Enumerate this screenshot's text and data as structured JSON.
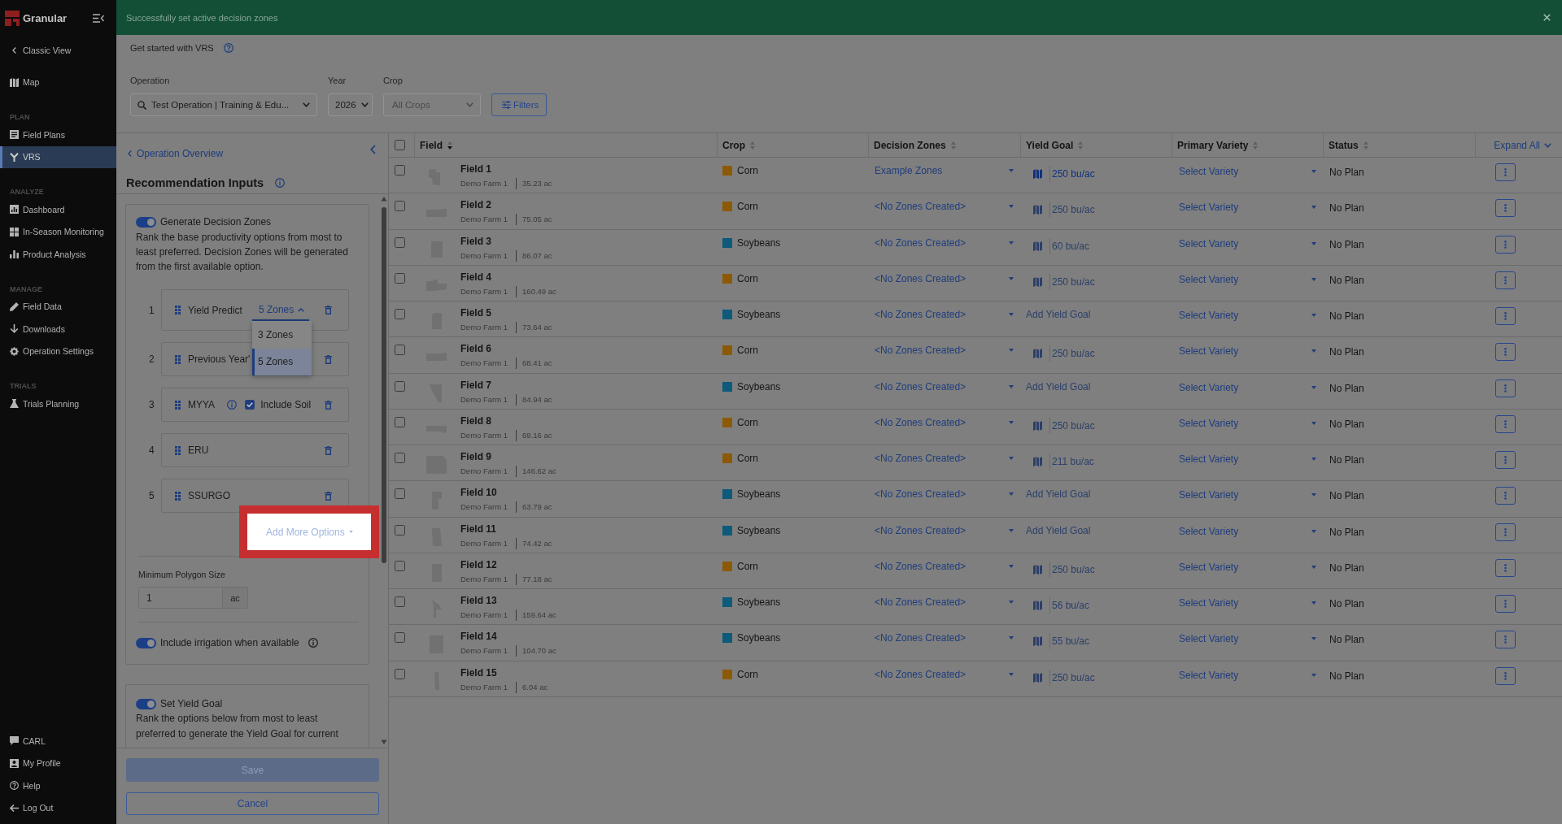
{
  "sidebar": {
    "brand": "Granular",
    "back_link": "Classic View",
    "sections": [
      {
        "items": [
          {
            "label": "Map",
            "selected": false
          }
        ]
      },
      {
        "heading": "PLAN",
        "items": [
          {
            "label": "Field Plans",
            "selected": false
          },
          {
            "label": "VRS",
            "selected": true
          }
        ]
      },
      {
        "heading": "ANALYZE",
        "items": [
          {
            "label": "Dashboard",
            "selected": false
          },
          {
            "label": "In-Season Monitoring",
            "selected": false
          },
          {
            "label": "Product Analysis",
            "selected": false
          }
        ]
      },
      {
        "heading": "MANAGE",
        "items": [
          {
            "label": "Field Data",
            "selected": false
          },
          {
            "label": "Downloads",
            "selected": false
          },
          {
            "label": "Operation Settings",
            "selected": false
          }
        ]
      },
      {
        "heading": "TRIALS",
        "items": [
          {
            "label": "Trials Planning",
            "selected": false
          }
        ]
      }
    ],
    "footer_items": [
      "CARL",
      "My Profile",
      "Help",
      "Log Out"
    ]
  },
  "toast": {
    "message": "Successfully set active decision zones"
  },
  "header": {
    "help_link": "Get started with VRS"
  },
  "filters": {
    "fields": [
      {
        "label": "Operation",
        "kind": "search-select",
        "value": "Test Operation | Training & Edu..."
      },
      {
        "label": "Year",
        "kind": "select",
        "value": "2026"
      },
      {
        "label": "Crop",
        "kind": "select",
        "placeholder": "All Crops"
      }
    ],
    "button": "Filters"
  },
  "panel": {
    "back_link": "Operation Overview",
    "title": "Recommendation Inputs",
    "zones_card": {
      "toggle": {
        "label": "Generate Decision Zones",
        "on": true
      },
      "description": "Rank the base productivity options from most to least preferred. Decision Zones will be generated from the first available option.",
      "options": [
        {
          "rank": "1",
          "label": "Yield Predict",
          "kind": "zones",
          "zones": {
            "value": "5 Zones",
            "expanded": true,
            "menu": [
              {
                "label": "3 Zones",
                "selected": false
              },
              {
                "label": "5 Zones",
                "selected": true
              }
            ]
          }
        },
        {
          "rank": "2",
          "label": "Previous Year'",
          "kind": "plain"
        },
        {
          "rank": "3",
          "label": "MYYA",
          "kind": "soil",
          "soil": {
            "label": "Include Soil",
            "checked": true
          }
        },
        {
          "rank": "4",
          "label": "ERU",
          "kind": "plain"
        },
        {
          "rank": "5",
          "label": "SSURGO",
          "kind": "plain"
        }
      ],
      "add_button": {
        "label": "Add More Options",
        "highlighted": true
      },
      "min_polygon": {
        "label": "Minimum Polygon Size",
        "value": "1",
        "unit": "ac"
      },
      "irrigation": {
        "label": "Include irrigation when available",
        "on": true
      }
    },
    "yield_card": {
      "toggle": {
        "label": "Set Yield Goal",
        "on": true
      },
      "description": "Rank the options below from most to least preferred to generate the Yield Goal for current"
    },
    "save": {
      "label": "Save",
      "disabled": true
    },
    "cancel": "Cancel"
  },
  "table": {
    "select_all": {
      "checked": false
    },
    "columns": [
      {
        "label": "Field",
        "sorted": true
      },
      {
        "label": "Crop",
        "sorted": false
      },
      {
        "label": "Decision Zones",
        "sorted": false
      },
      {
        "label": "Yield Goal",
        "sorted": false
      },
      {
        "label": "Primary Variety",
        "sorted": false
      },
      {
        "label": "Status",
        "sorted": false
      }
    ],
    "expand_all": "Expand All",
    "rows": [
      {
        "selected": false,
        "name": "Field 1",
        "farm": "Demo Farm 1",
        "area": "35.23 ac",
        "crop": {
          "name": "Corn",
          "color": "#8c5a06"
        },
        "decision_zones": "Example Zones",
        "yield_goal": {
          "kind": "value",
          "text": "250 bu/ac",
          "disabled": false
        },
        "variety": "Select Variety",
        "status": "No Plan"
      },
      {
        "selected": false,
        "name": "Field 2",
        "farm": "Demo Farm 1",
        "area": "75.05 ac",
        "crop": {
          "name": "Corn",
          "color": "#8c5a06"
        },
        "decision_zones": "<No Zones Created>",
        "yield_goal": {
          "kind": "value",
          "text": "250 bu/ac",
          "disabled": true
        },
        "variety": "Select Variety",
        "status": "No Plan"
      },
      {
        "selected": false,
        "name": "Field 3",
        "farm": "Demo Farm 1",
        "area": "86.07 ac",
        "crop": {
          "name": "Soybeans",
          "color": "#0d5a7b"
        },
        "decision_zones": "<No Zones Created>",
        "yield_goal": {
          "kind": "value",
          "text": "60 bu/ac",
          "disabled": true
        },
        "variety": "Select Variety",
        "status": "No Plan"
      },
      {
        "selected": false,
        "name": "Field 4",
        "farm": "Demo Farm 1",
        "area": "160.49 ac",
        "crop": {
          "name": "Corn",
          "color": "#8c5a06"
        },
        "decision_zones": "<No Zones Created>",
        "yield_goal": {
          "kind": "value",
          "text": "250 bu/ac",
          "disabled": true
        },
        "variety": "Select Variety",
        "status": "No Plan"
      },
      {
        "selected": false,
        "name": "Field 5",
        "farm": "Demo Farm 1",
        "area": "73.64 ac",
        "crop": {
          "name": "Soybeans",
          "color": "#0d5a7b"
        },
        "decision_zones": "<No Zones Created>",
        "yield_goal": {
          "kind": "add",
          "text": "Add Yield Goal",
          "disabled": true
        },
        "variety": "Select Variety",
        "status": "No Plan"
      },
      {
        "selected": false,
        "name": "Field 6",
        "farm": "Demo Farm 1",
        "area": "68.41 ac",
        "crop": {
          "name": "Corn",
          "color": "#8c5a06"
        },
        "decision_zones": "<No Zones Created>",
        "yield_goal": {
          "kind": "value",
          "text": "250 bu/ac",
          "disabled": true
        },
        "variety": "Select Variety",
        "status": "No Plan"
      },
      {
        "selected": false,
        "name": "Field 7",
        "farm": "Demo Farm 1",
        "area": "84.94 ac",
        "crop": {
          "name": "Soybeans",
          "color": "#0d5a7b"
        },
        "decision_zones": "<No Zones Created>",
        "yield_goal": {
          "kind": "add",
          "text": "Add Yield Goal",
          "disabled": true
        },
        "variety": "Select Variety",
        "status": "No Plan"
      },
      {
        "selected": false,
        "name": "Field 8",
        "farm": "Demo Farm 1",
        "area": "69.16 ac",
        "crop": {
          "name": "Corn",
          "color": "#8c5a06"
        },
        "decision_zones": "<No Zones Created>",
        "yield_goal": {
          "kind": "value",
          "text": "250 bu/ac",
          "disabled": true
        },
        "variety": "Select Variety",
        "status": "No Plan"
      },
      {
        "selected": false,
        "name": "Field 9",
        "farm": "Demo Farm 1",
        "area": "146.62 ac",
        "crop": {
          "name": "Corn",
          "color": "#8c5a06"
        },
        "decision_zones": "<No Zones Created>",
        "yield_goal": {
          "kind": "value",
          "text": "211 bu/ac",
          "disabled": true
        },
        "variety": "Select Variety",
        "status": "No Plan"
      },
      {
        "selected": false,
        "name": "Field 10",
        "farm": "Demo Farm 1",
        "area": "63.79 ac",
        "crop": {
          "name": "Soybeans",
          "color": "#0d5a7b"
        },
        "decision_zones": "<No Zones Created>",
        "yield_goal": {
          "kind": "add",
          "text": "Add Yield Goal",
          "disabled": true
        },
        "variety": "Select Variety",
        "status": "No Plan"
      },
      {
        "selected": false,
        "name": "Field 11",
        "farm": "Demo Farm 1",
        "area": "74.42 ac",
        "crop": {
          "name": "Soybeans",
          "color": "#0d5a7b"
        },
        "decision_zones": "<No Zones Created>",
        "yield_goal": {
          "kind": "add",
          "text": "Add Yield Goal",
          "disabled": true
        },
        "variety": "Select Variety",
        "status": "No Plan"
      },
      {
        "selected": false,
        "name": "Field 12",
        "farm": "Demo Farm 1",
        "area": "77.18 ac",
        "crop": {
          "name": "Corn",
          "color": "#8c5a06"
        },
        "decision_zones": "<No Zones Created>",
        "yield_goal": {
          "kind": "value",
          "text": "250 bu/ac",
          "disabled": true
        },
        "variety": "Select Variety",
        "status": "No Plan"
      },
      {
        "selected": false,
        "name": "Field 13",
        "farm": "Demo Farm 1",
        "area": "159.64 ac",
        "crop": {
          "name": "Soybeans",
          "color": "#0d5a7b"
        },
        "decision_zones": "<No Zones Created>",
        "yield_goal": {
          "kind": "value",
          "text": "56 bu/ac",
          "disabled": true
        },
        "variety": "Select Variety",
        "status": "No Plan"
      },
      {
        "selected": false,
        "name": "Field 14",
        "farm": "Demo Farm 1",
        "area": "104.70 ac",
        "crop": {
          "name": "Soybeans",
          "color": "#0d5a7b"
        },
        "decision_zones": "<No Zones Created>",
        "yield_goal": {
          "kind": "value",
          "text": "55 bu/ac",
          "disabled": true
        },
        "variety": "Select Variety",
        "status": "No Plan"
      },
      {
        "selected": false,
        "name": "Field 15",
        "farm": "Demo Farm 1",
        "area": "6.04 ac",
        "crop": {
          "name": "Corn",
          "color": "#8c5a06"
        },
        "decision_zones": "<No Zones Created>",
        "yield_goal": {
          "kind": "value",
          "text": "250 bu/ac",
          "disabled": true
        },
        "variety": "Select Variety",
        "status": "No Plan"
      }
    ]
  }
}
